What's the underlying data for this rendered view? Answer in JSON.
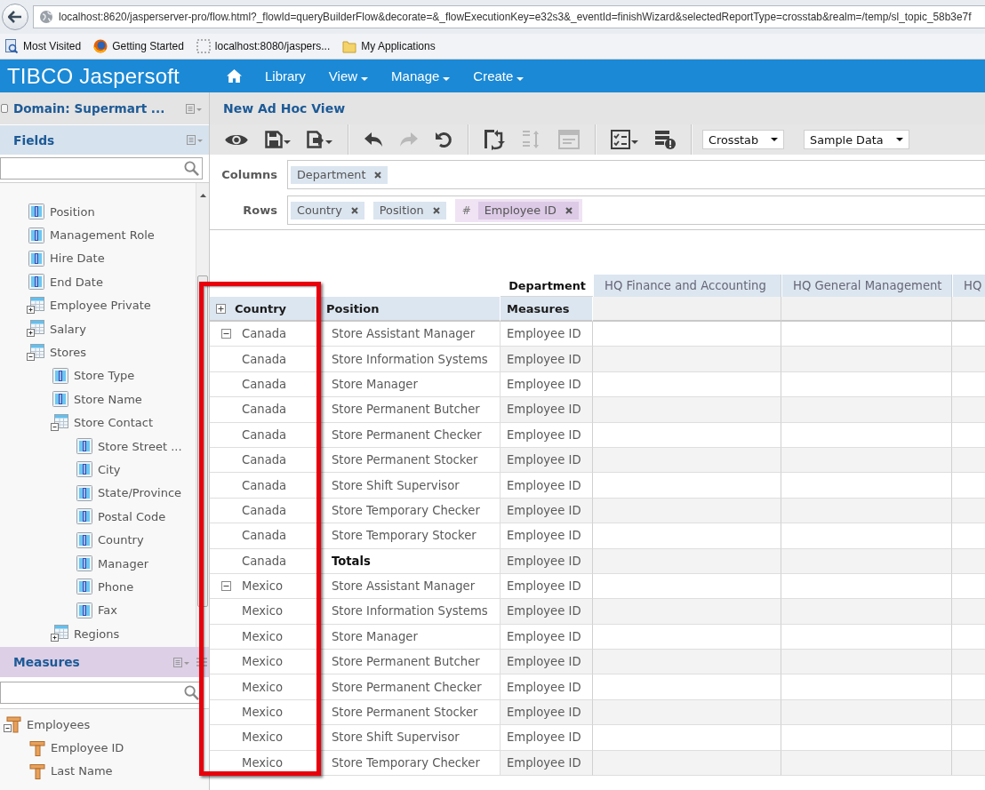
{
  "browser": {
    "url": "localhost:8620/jasperserver-pro/flow.html?_flowId=queryBuilderFlow&decorate=&_flowExecutionKey=e32s3&_eventId=finishWizard&selectedReportType=crosstab&realm=/temp/sl_topic_58b3e7f",
    "bookmarks": [
      {
        "label": "Most Visited"
      },
      {
        "label": "Getting Started"
      },
      {
        "label": "localhost:8080/jaspers..."
      },
      {
        "label": "My Applications"
      }
    ]
  },
  "app_header": {
    "logo": "TIBCO Jaspersoft",
    "nav": [
      {
        "label": "Library",
        "menu": false
      },
      {
        "label": "View",
        "menu": true
      },
      {
        "label": "Manage",
        "menu": true
      },
      {
        "label": "Create",
        "menu": true
      }
    ]
  },
  "sidebar": {
    "domain_title": "Domain: Supermart ...",
    "fields": {
      "title": "Fields",
      "items": [
        {
          "label": "Position",
          "kind": "field"
        },
        {
          "label": "Management Role",
          "kind": "field"
        },
        {
          "label": "Hire Date",
          "kind": "field"
        },
        {
          "label": "End Date",
          "kind": "field"
        },
        {
          "label": "Employee Private",
          "kind": "set",
          "expanded": false
        },
        {
          "label": "Salary",
          "kind": "set",
          "expanded": false
        },
        {
          "label": "Stores",
          "kind": "set",
          "expanded": true,
          "children": [
            {
              "label": "Store Type",
              "kind": "field"
            },
            {
              "label": "Store Name",
              "kind": "field"
            },
            {
              "label": "Store Contact",
              "kind": "set",
              "expanded": true,
              "children": [
                {
                  "label": "Store Street ...",
                  "kind": "field"
                },
                {
                  "label": "City",
                  "kind": "field"
                },
                {
                  "label": "State/Province",
                  "kind": "field"
                },
                {
                  "label": "Postal Code",
                  "kind": "field"
                },
                {
                  "label": "Country",
                  "kind": "field"
                },
                {
                  "label": "Manager",
                  "kind": "field"
                },
                {
                  "label": "Phone",
                  "kind": "field"
                },
                {
                  "label": "Fax",
                  "kind": "field"
                }
              ]
            },
            {
              "label": "Regions",
              "kind": "set",
              "expanded": false
            }
          ]
        }
      ]
    },
    "measures": {
      "title": "Measures",
      "items": [
        {
          "label": "Employees",
          "kind": "measure_set",
          "expanded": true,
          "children": [
            {
              "label": "Employee ID",
              "kind": "measure"
            },
            {
              "label": "Last Name",
              "kind": "measure"
            }
          ]
        }
      ]
    }
  },
  "view": {
    "title": "New Ad Hoc View",
    "toolbar": {
      "groups": [
        [
          {
            "menu": false,
            "disabled": false
          },
          {
            "menu": true,
            "disabled": false
          },
          {
            "menu": true,
            "disabled": false
          }
        ],
        [
          {
            "menu": false,
            "disabled": false
          },
          {
            "menu": false,
            "disabled": true
          },
          {
            "menu": false,
            "disabled": false
          }
        ],
        [
          {
            "menu": false,
            "disabled": false
          },
          {
            "menu": false,
            "disabled": true
          },
          {
            "menu": false,
            "disabled": true
          }
        ],
        [
          {
            "menu": true,
            "disabled": false
          },
          {
            "menu": false,
            "disabled": false
          }
        ]
      ],
      "selects": [
        {
          "value": "Crosstab"
        },
        {
          "value": "Sample Data"
        }
      ]
    },
    "columns": {
      "label": "Columns",
      "items": [
        {
          "kind": "dimension",
          "label": "Department"
        }
      ]
    },
    "rows": {
      "label": "Rows",
      "items": [
        {
          "kind": "dimension",
          "label": "Country"
        },
        {
          "kind": "dimension",
          "label": "Position"
        },
        {
          "kind": "measures",
          "marker": "#",
          "items": [
            {
              "label": "Employee ID"
            }
          ]
        }
      ]
    },
    "crosstab": {
      "column_dimension": "Department",
      "column_headers": [
        "HQ Finance and Accounting",
        "HQ General Management",
        "HQ"
      ],
      "row_headers": [
        "Country",
        "Position",
        "Measures"
      ],
      "country_column_highlighted": true,
      "groups": [
        {
          "expanded": true,
          "rows": [
            {
              "kind": "member",
              "country": "Canada",
              "position": "Store Assistant Manager",
              "measure": "Employee ID"
            },
            {
              "kind": "member",
              "country": "Canada",
              "position": "Store Information Systems",
              "measure": "Employee ID"
            },
            {
              "kind": "member",
              "country": "Canada",
              "position": "Store Manager",
              "measure": "Employee ID"
            },
            {
              "kind": "member",
              "country": "Canada",
              "position": "Store Permanent Butcher",
              "measure": "Employee ID"
            },
            {
              "kind": "member",
              "country": "Canada",
              "position": "Store Permanent Checker",
              "measure": "Employee ID"
            },
            {
              "kind": "member",
              "country": "Canada",
              "position": "Store Permanent Stocker",
              "measure": "Employee ID"
            },
            {
              "kind": "member",
              "country": "Canada",
              "position": "Store Shift Supervisor",
              "measure": "Employee ID"
            },
            {
              "kind": "member",
              "country": "Canada",
              "position": "Store Temporary Checker",
              "measure": "Employee ID"
            },
            {
              "kind": "member",
              "country": "Canada",
              "position": "Store Temporary Stocker",
              "measure": "Employee ID"
            },
            {
              "kind": "total",
              "country": "Canada",
              "position": "Totals",
              "measure": "Employee ID"
            }
          ]
        },
        {
          "expanded": true,
          "rows": [
            {
              "kind": "member",
              "country": "Mexico",
              "position": "Store Assistant Manager",
              "measure": "Employee ID"
            },
            {
              "kind": "member",
              "country": "Mexico",
              "position": "Store Information Systems",
              "measure": "Employee ID"
            },
            {
              "kind": "member",
              "country": "Mexico",
              "position": "Store Manager",
              "measure": "Employee ID"
            },
            {
              "kind": "member",
              "country": "Mexico",
              "position": "Store Permanent Butcher",
              "measure": "Employee ID"
            },
            {
              "kind": "member",
              "country": "Mexico",
              "position": "Store Permanent Checker",
              "measure": "Employee ID"
            },
            {
              "kind": "member",
              "country": "Mexico",
              "position": "Store Permanent Stocker",
              "measure": "Employee ID"
            },
            {
              "kind": "member",
              "country": "Mexico",
              "position": "Store Shift Supervisor",
              "measure": "Employee ID"
            },
            {
              "kind": "member",
              "country": "Mexico",
              "position": "Store Temporary Checker",
              "measure": "Employee ID"
            }
          ]
        }
      ]
    }
  }
}
